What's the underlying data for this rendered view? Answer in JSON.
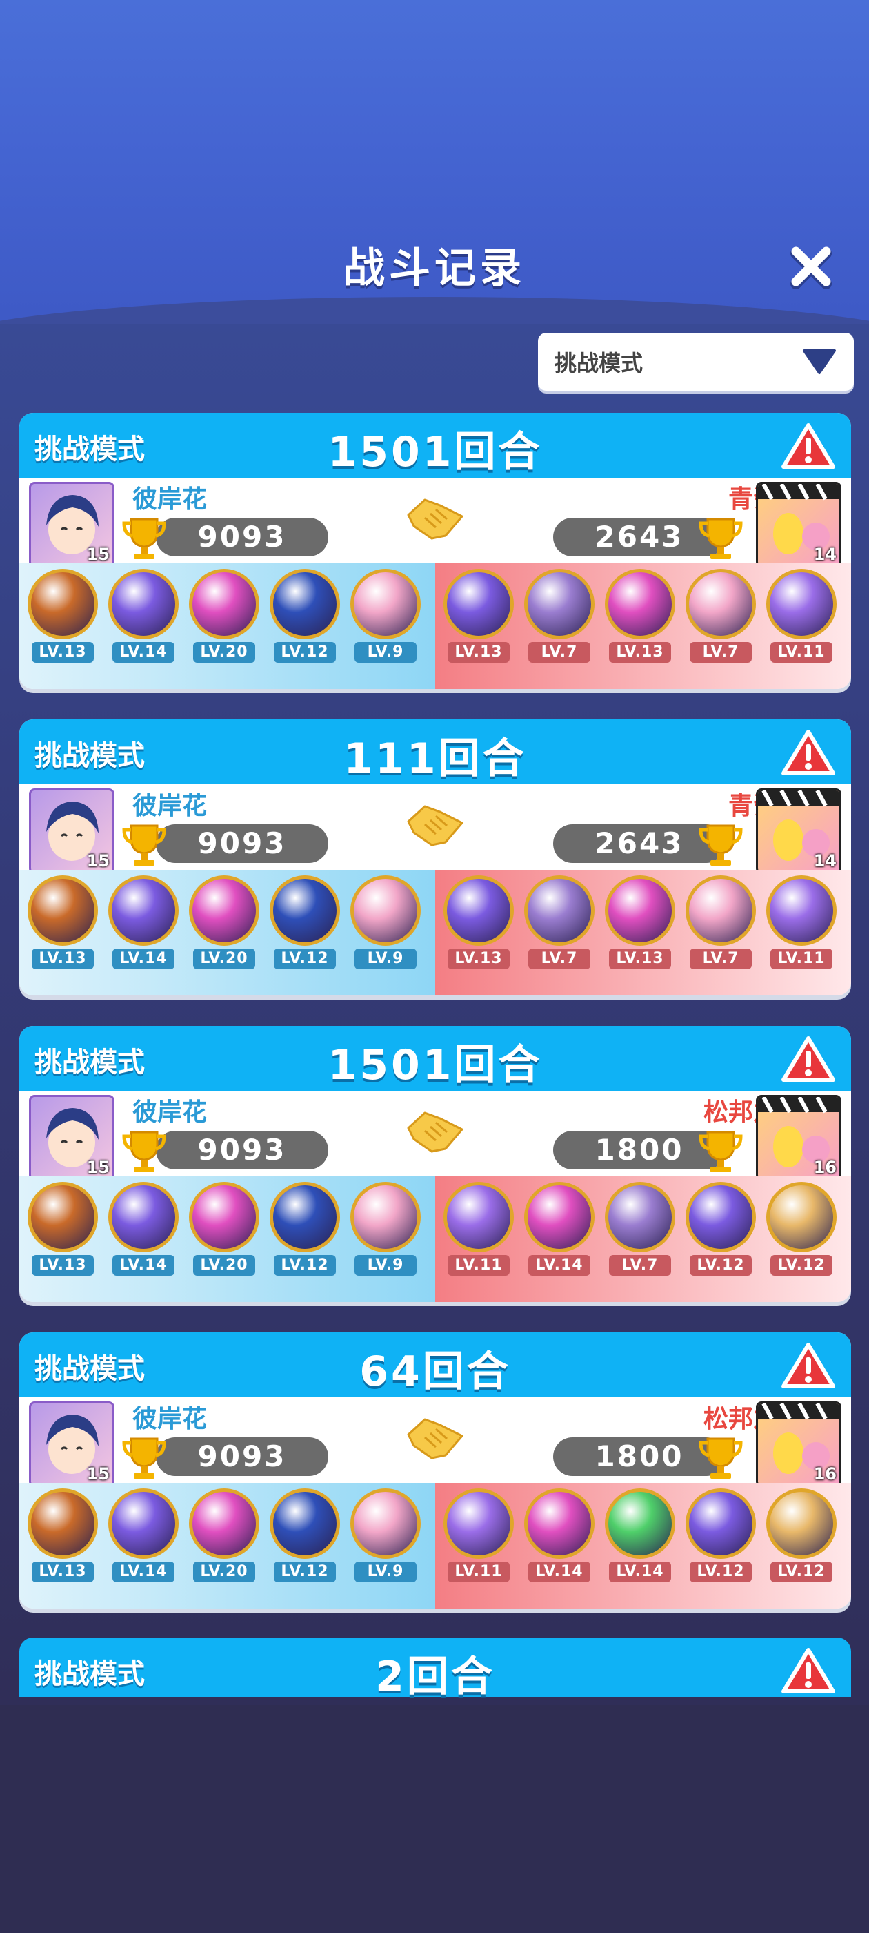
{
  "header": {
    "title": "战斗记录"
  },
  "filter": {
    "label": "挑战模式"
  },
  "colors": {
    "accent": "#0fb2f5",
    "left_name": "#2a9ad6",
    "right_name": "#e8473f"
  },
  "records": [
    {
      "mode": "挑战模式",
      "rounds": "1501回合",
      "left": {
        "name": "彼岸花",
        "score": "9093",
        "level": "15",
        "pets": [
          {
            "lv": "LV.13",
            "color": "#c96a2a"
          },
          {
            "lv": "LV.14",
            "color": "#7b5be0"
          },
          {
            "lv": "LV.20",
            "color": "#e04fc0"
          },
          {
            "lv": "LV.12",
            "color": "#2e4fb8"
          },
          {
            "lv": "LV.9",
            "color": "#f2a6c8"
          }
        ]
      },
      "right": {
        "name": "青瓷",
        "score": "2643",
        "level": "14",
        "pets": [
          {
            "lv": "LV.13",
            "color": "#7b5be0"
          },
          {
            "lv": "LV.7",
            "color": "#9a7dd0"
          },
          {
            "lv": "LV.13",
            "color": "#e04fc0"
          },
          {
            "lv": "LV.7",
            "color": "#f2a6c8"
          },
          {
            "lv": "LV.11",
            "color": "#9a6de8"
          }
        ]
      }
    },
    {
      "mode": "挑战模式",
      "rounds": "111回合",
      "left": {
        "name": "彼岸花",
        "score": "9093",
        "level": "15",
        "pets": [
          {
            "lv": "LV.13",
            "color": "#c96a2a"
          },
          {
            "lv": "LV.14",
            "color": "#7b5be0"
          },
          {
            "lv": "LV.20",
            "color": "#e04fc0"
          },
          {
            "lv": "LV.12",
            "color": "#2e4fb8"
          },
          {
            "lv": "LV.9",
            "color": "#f2a6c8"
          }
        ]
      },
      "right": {
        "name": "青瓷",
        "score": "2643",
        "level": "14",
        "pets": [
          {
            "lv": "LV.13",
            "color": "#7b5be0"
          },
          {
            "lv": "LV.7",
            "color": "#9a7dd0"
          },
          {
            "lv": "LV.13",
            "color": "#e04fc0"
          },
          {
            "lv": "LV.7",
            "color": "#f2a6c8"
          },
          {
            "lv": "LV.11",
            "color": "#9a6de8"
          }
        ]
      }
    },
    {
      "mode": "挑战模式",
      "rounds": "1501回合",
      "left": {
        "name": "彼岸花",
        "score": "9093",
        "level": "15",
        "pets": [
          {
            "lv": "LV.13",
            "color": "#c96a2a"
          },
          {
            "lv": "LV.14",
            "color": "#7b5be0"
          },
          {
            "lv": "LV.20",
            "color": "#e04fc0"
          },
          {
            "lv": "LV.12",
            "color": "#2e4fb8"
          },
          {
            "lv": "LV.9",
            "color": "#f2a6c8"
          }
        ]
      },
      "right": {
        "name": "松邦之",
        "score": "1800",
        "level": "16",
        "pets": [
          {
            "lv": "LV.11",
            "color": "#9a6de8"
          },
          {
            "lv": "LV.14",
            "color": "#e04fc0"
          },
          {
            "lv": "LV.7",
            "color": "#9a7dd0"
          },
          {
            "lv": "LV.12",
            "color": "#7b5be0"
          },
          {
            "lv": "LV.12",
            "color": "#e8b86a"
          }
        ]
      }
    },
    {
      "mode": "挑战模式",
      "rounds": "64回合",
      "left": {
        "name": "彼岸花",
        "score": "9093",
        "level": "15",
        "pets": [
          {
            "lv": "LV.13",
            "color": "#c96a2a"
          },
          {
            "lv": "LV.14",
            "color": "#7b5be0"
          },
          {
            "lv": "LV.20",
            "color": "#e04fc0"
          },
          {
            "lv": "LV.12",
            "color": "#2e4fb8"
          },
          {
            "lv": "LV.9",
            "color": "#f2a6c8"
          }
        ]
      },
      "right": {
        "name": "松邦之",
        "score": "1800",
        "level": "16",
        "pets": [
          {
            "lv": "LV.11",
            "color": "#9a6de8"
          },
          {
            "lv": "LV.14",
            "color": "#e04fc0"
          },
          {
            "lv": "LV.14",
            "color": "#4fcf6a"
          },
          {
            "lv": "LV.12",
            "color": "#7b5be0"
          },
          {
            "lv": "LV.12",
            "color": "#e8b86a"
          }
        ]
      }
    }
  ],
  "partial": {
    "mode": "挑战模式",
    "rounds": "2回合"
  }
}
